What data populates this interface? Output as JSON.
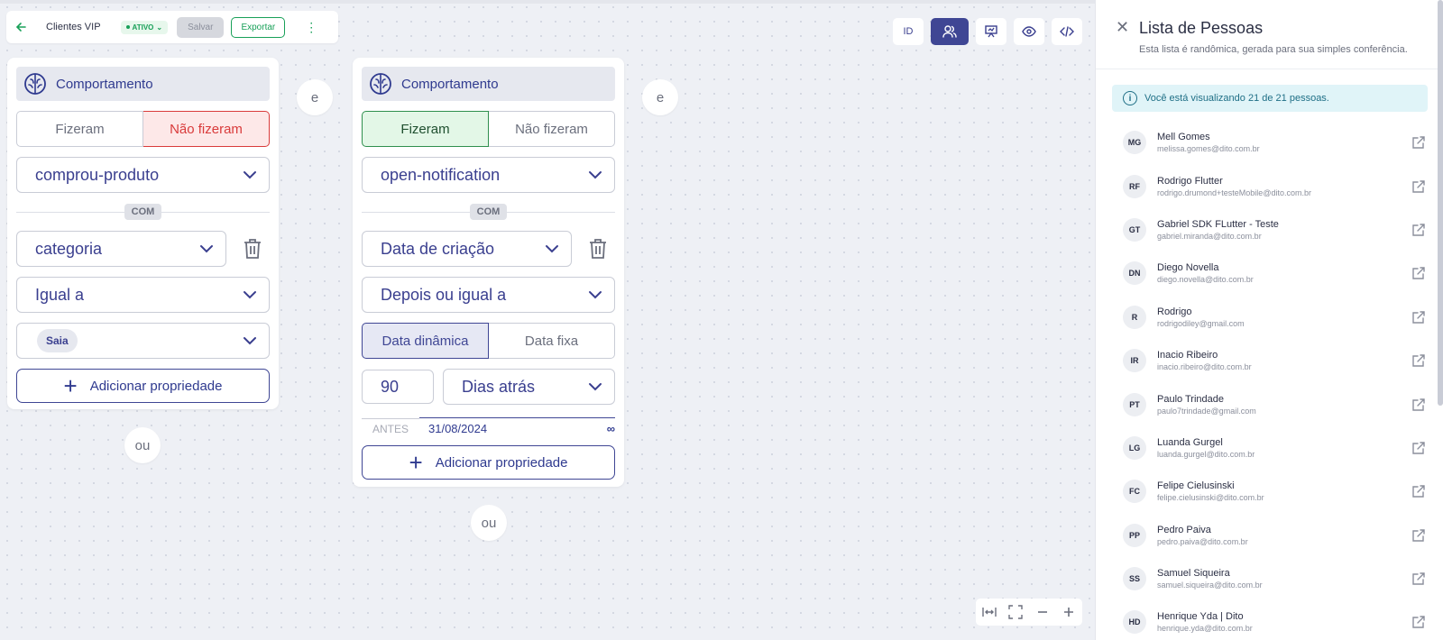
{
  "toolbar": {
    "list_name": "Clientes VIP",
    "status": "ATIVO",
    "save_label": "Salvar",
    "export_label": "Exportar"
  },
  "viewbar": {
    "id_label": "ID"
  },
  "cards": [
    {
      "header": "Comportamento",
      "did_label": "Fizeram",
      "did_not_label": "Não fizeram",
      "event": "comprou-produto",
      "with_label": "COM",
      "property": "categoria",
      "operator": "Igual a",
      "value_chip": "Saia",
      "add_property": "Adicionar propriedade"
    },
    {
      "header": "Comportamento",
      "did_label": "Fizeram",
      "did_not_label": "Não fizeram",
      "event": "open-notification",
      "with_label": "COM",
      "property": "Data de criação",
      "operator": "Depois ou igual a",
      "dynamic_label": "Data dinâmica",
      "fixed_label": "Data fixa",
      "amount": "90",
      "unit": "Dias atrás",
      "before_label": "ANTES",
      "date_value": "31/08/2024",
      "infinity": "∞",
      "add_property": "Adicionar propriedade"
    }
  ],
  "connectors": {
    "and": "e",
    "or": "ou"
  },
  "panel": {
    "title": "Lista de Pessoas",
    "subtitle": "Esta lista é randômica, gerada para sua simples conferência.",
    "info": "Você está visualizando 21 de 21 pessoas.",
    "people": [
      {
        "initials": "MG",
        "name": "Mell Gomes",
        "email": "melissa.gomes@dito.com.br"
      },
      {
        "initials": "RF",
        "name": "Rodrigo Flutter",
        "email": "rodrigo.drumond+testeMobile@dito.com.br"
      },
      {
        "initials": "GT",
        "name": "Gabriel SDK FLutter - Teste",
        "email": "gabriel.miranda@dito.com.br"
      },
      {
        "initials": "DN",
        "name": "Diego Novella",
        "email": "diego.novella@dito.com.br"
      },
      {
        "initials": "R",
        "name": "Rodrigo",
        "email": "rodrigodiley@gmail.com"
      },
      {
        "initials": "IR",
        "name": "Inacio Ribeiro",
        "email": "inacio.ribeiro@dito.com.br"
      },
      {
        "initials": "PT",
        "name": "Paulo Trindade",
        "email": "paulo7trindade@gmail.com"
      },
      {
        "initials": "LG",
        "name": "Luanda Gurgel",
        "email": "luanda.gurgel@dito.com.br"
      },
      {
        "initials": "FC",
        "name": "Felipe Cielusinski",
        "email": "felipe.cielusinski@dito.com.br"
      },
      {
        "initials": "PP",
        "name": "Pedro Paiva",
        "email": "pedro.paiva@dito.com.br"
      },
      {
        "initials": "SS",
        "name": "Samuel Siqueira",
        "email": "samuel.siqueira@dito.com.br"
      },
      {
        "initials": "HD",
        "name": "Henrique Yda | Dito",
        "email": "henrique.yda@dito.com.br"
      }
    ]
  }
}
